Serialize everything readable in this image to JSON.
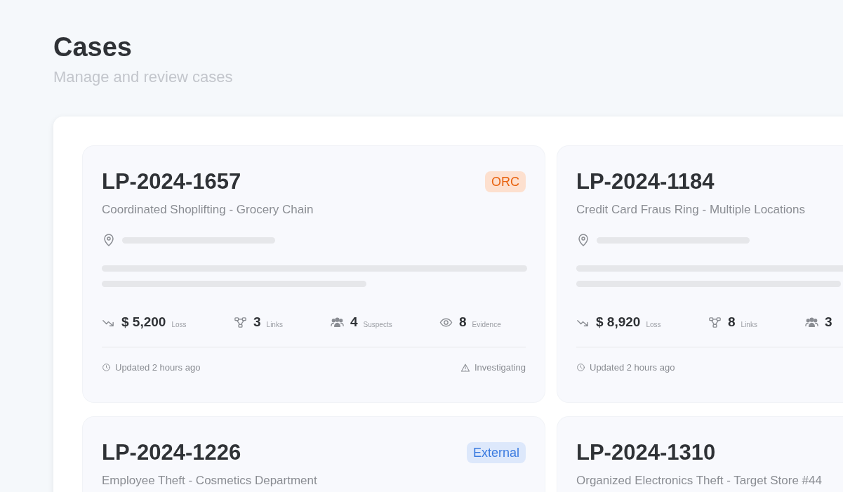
{
  "page": {
    "title": "Cases",
    "subtitle": "Manage and review cases"
  },
  "cases": [
    {
      "id": "LP-2024-1657",
      "title": "Coordinated Shoplifting - Grocery Chain",
      "tag": {
        "label": "ORC",
        "kind": "orc"
      },
      "loading": true,
      "stats": [
        {
          "kind": "loss",
          "value": "$ 5,200",
          "label": "Loss"
        },
        {
          "kind": "links",
          "value": "3",
          "label": "Links"
        },
        {
          "kind": "suspects",
          "value": "4",
          "label": "Suspects"
        },
        {
          "kind": "evidence",
          "value": "8",
          "label": "Evidence"
        }
      ],
      "updated": "Updated 2 hours ago",
      "status": "Investigating"
    },
    {
      "id": "LP-2024-1184",
      "title": "Credit Card Fraus Ring - Multiple Locations",
      "loading": true,
      "stats": [
        {
          "kind": "loss",
          "value": "$ 8,920",
          "label": "Loss"
        },
        {
          "kind": "links",
          "value": "8",
          "label": "Links"
        },
        {
          "kind": "suspects",
          "value": "3"
        }
      ],
      "updated": "Updated 2 hours ago"
    },
    {
      "id": "LP-2024-1226",
      "title": "Employee Theft - Cosmetics Department",
      "tag": {
        "label": "External",
        "kind": "external"
      }
    },
    {
      "id": "LP-2024-1310",
      "title": "Organized Electronics Theft - Target Store #44"
    }
  ]
}
